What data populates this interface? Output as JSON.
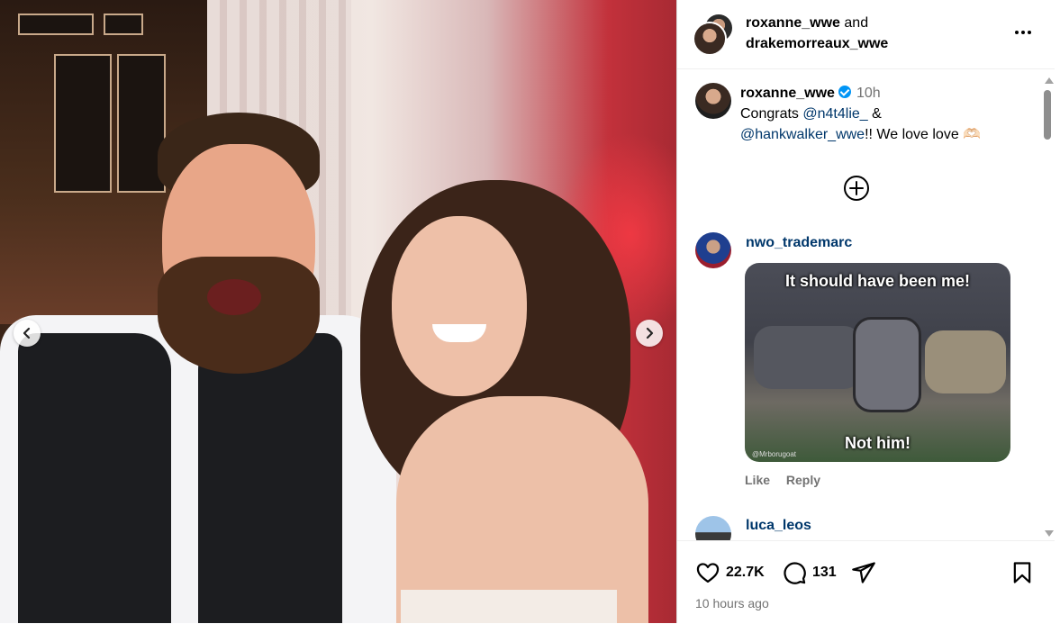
{
  "header": {
    "user1": "roxanne_wwe",
    "joiner": "and",
    "user2": "drakemorreaux_wwe",
    "more_icon": "more-horizontal-icon"
  },
  "caption": {
    "username": "roxanne_wwe",
    "time": "10h",
    "text_start": "Congrats ",
    "mention1": "@n4t4lie_",
    "text_mid": " &",
    "mention2": "@hankwalker_wwe",
    "text_end": "!! We love love 🫶🏻"
  },
  "comments": [
    {
      "username": "nwo_trademarc",
      "gif_top_text": "It should have been me!",
      "gif_bottom_text": "Not him!",
      "gif_credit": "@Mrborugoat",
      "like_label": "Like",
      "reply_label": "Reply"
    },
    {
      "username": "luca_leos"
    }
  ],
  "footer": {
    "likes": "22.7K",
    "comments": "131",
    "timestamp": "10 hours ago"
  },
  "colors": {
    "link": "#00376b",
    "verified": "#0095f6",
    "muted": "#737373"
  }
}
